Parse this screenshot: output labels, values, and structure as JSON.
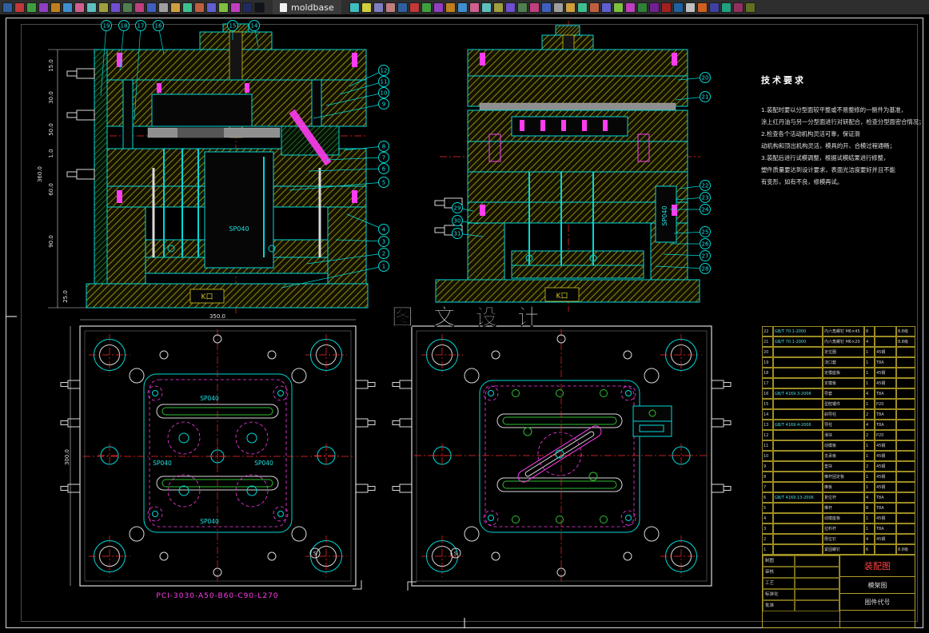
{
  "toolbar": {
    "tab_label": "moldbase"
  },
  "watermark": "图 文 设 计",
  "labels": {
    "sp": "SP040",
    "gate": "K口",
    "datum": "S"
  },
  "dims": {
    "v1_left": [
      "15.0",
      "30.0",
      "50.0",
      "1.0",
      "60.0",
      "90.0",
      "360.0"
    ],
    "v1_bottom": "25.0",
    "v3_left": "300.0",
    "v3_top": "350.0"
  },
  "balloons": {
    "v1_top": [
      "19",
      "18",
      "17",
      "16",
      "15",
      "14"
    ],
    "v1_right": [
      "12",
      "11",
      "10",
      "9",
      "8",
      "7",
      "6",
      "5",
      "4",
      "3",
      "2",
      "1"
    ],
    "v2_right": [
      "20",
      "21",
      "22",
      "23",
      "24",
      "25",
      "26",
      "27",
      "28"
    ],
    "v2_left": [
      "29",
      "30",
      "31"
    ]
  },
  "tech_requirements": {
    "title": "技术要求",
    "items": [
      "1.装配时要以分型面较平整或不易整修的一侧件为基准，",
      "涂上红丹油与另一分型面进行对研配合，检查分型面密合情况；",
      "2.检查各个活动机构灵活可靠，保证滑",
      "动机构和顶出机构灵活，模具的开、合模过程通畅；",
      "3.装配后进行试模调整，根据试模结果进行修整，",
      "塑件质量要达到设计要求，表面光洁度要好并且不能",
      "有变形，如有不良，修模再试。"
    ]
  },
  "plan": {
    "part_number": "PCI-3030-A50-B60-C90-L270"
  },
  "bom": {
    "rows": [
      [
        "22",
        "GB/T 70.1-2000",
        "内六角螺钉 M6×45",
        "8",
        "",
        "8.8级"
      ],
      [
        "21",
        "GB/T 70.1-2000",
        "内六角螺钉 M6×20",
        "4",
        "",
        "8.8级"
      ],
      [
        "20",
        "",
        "定位圈",
        "1",
        "45钢",
        ""
      ],
      [
        "19",
        "",
        "浇口套",
        "1",
        "T8A",
        ""
      ],
      [
        "18",
        "",
        "定模座板",
        "1",
        "45钢",
        ""
      ],
      [
        "17",
        "",
        "定模板",
        "1",
        "45钢",
        ""
      ],
      [
        "16",
        "GB/T 4169.3-2006",
        "导套",
        "4",
        "T8A",
        ""
      ],
      [
        "15",
        "",
        "型腔镶件",
        "1",
        "P20",
        ""
      ],
      [
        "14",
        "",
        "斜导柱",
        "2",
        "T8A",
        ""
      ],
      [
        "13",
        "GB/T 4169.4-2006",
        "导柱",
        "4",
        "T8A",
        ""
      ],
      [
        "12",
        "",
        "滑块",
        "2",
        "P20",
        ""
      ],
      [
        "11",
        "",
        "动模板",
        "1",
        "45钢",
        ""
      ],
      [
        "10",
        "",
        "支承板",
        "1",
        "45钢",
        ""
      ],
      [
        "9",
        "",
        "垫块",
        "2",
        "45钢",
        ""
      ],
      [
        "8",
        "",
        "推杆固定板",
        "1",
        "45钢",
        ""
      ],
      [
        "7",
        "",
        "推板",
        "1",
        "45钢",
        ""
      ],
      [
        "6",
        "GB/T 4169.13-2006",
        "复位杆",
        "4",
        "T8A",
        ""
      ],
      [
        "5",
        "",
        "推杆",
        "8",
        "T8A",
        ""
      ],
      [
        "4",
        "",
        "动模座板",
        "1",
        "45钢",
        ""
      ],
      [
        "3",
        "",
        "拉料杆",
        "1",
        "T8A",
        ""
      ],
      [
        "2",
        "",
        "限位钉",
        "4",
        "45钢",
        ""
      ],
      [
        "1",
        "",
        "紧固螺钉",
        "6",
        "",
        "8.8级"
      ]
    ]
  },
  "title_block": {
    "name": "装配图",
    "type": "模架图",
    "code_label": "图件代号",
    "sign_labels": [
      "制图",
      "审核",
      "工艺",
      "标准化",
      "批准"
    ]
  }
}
